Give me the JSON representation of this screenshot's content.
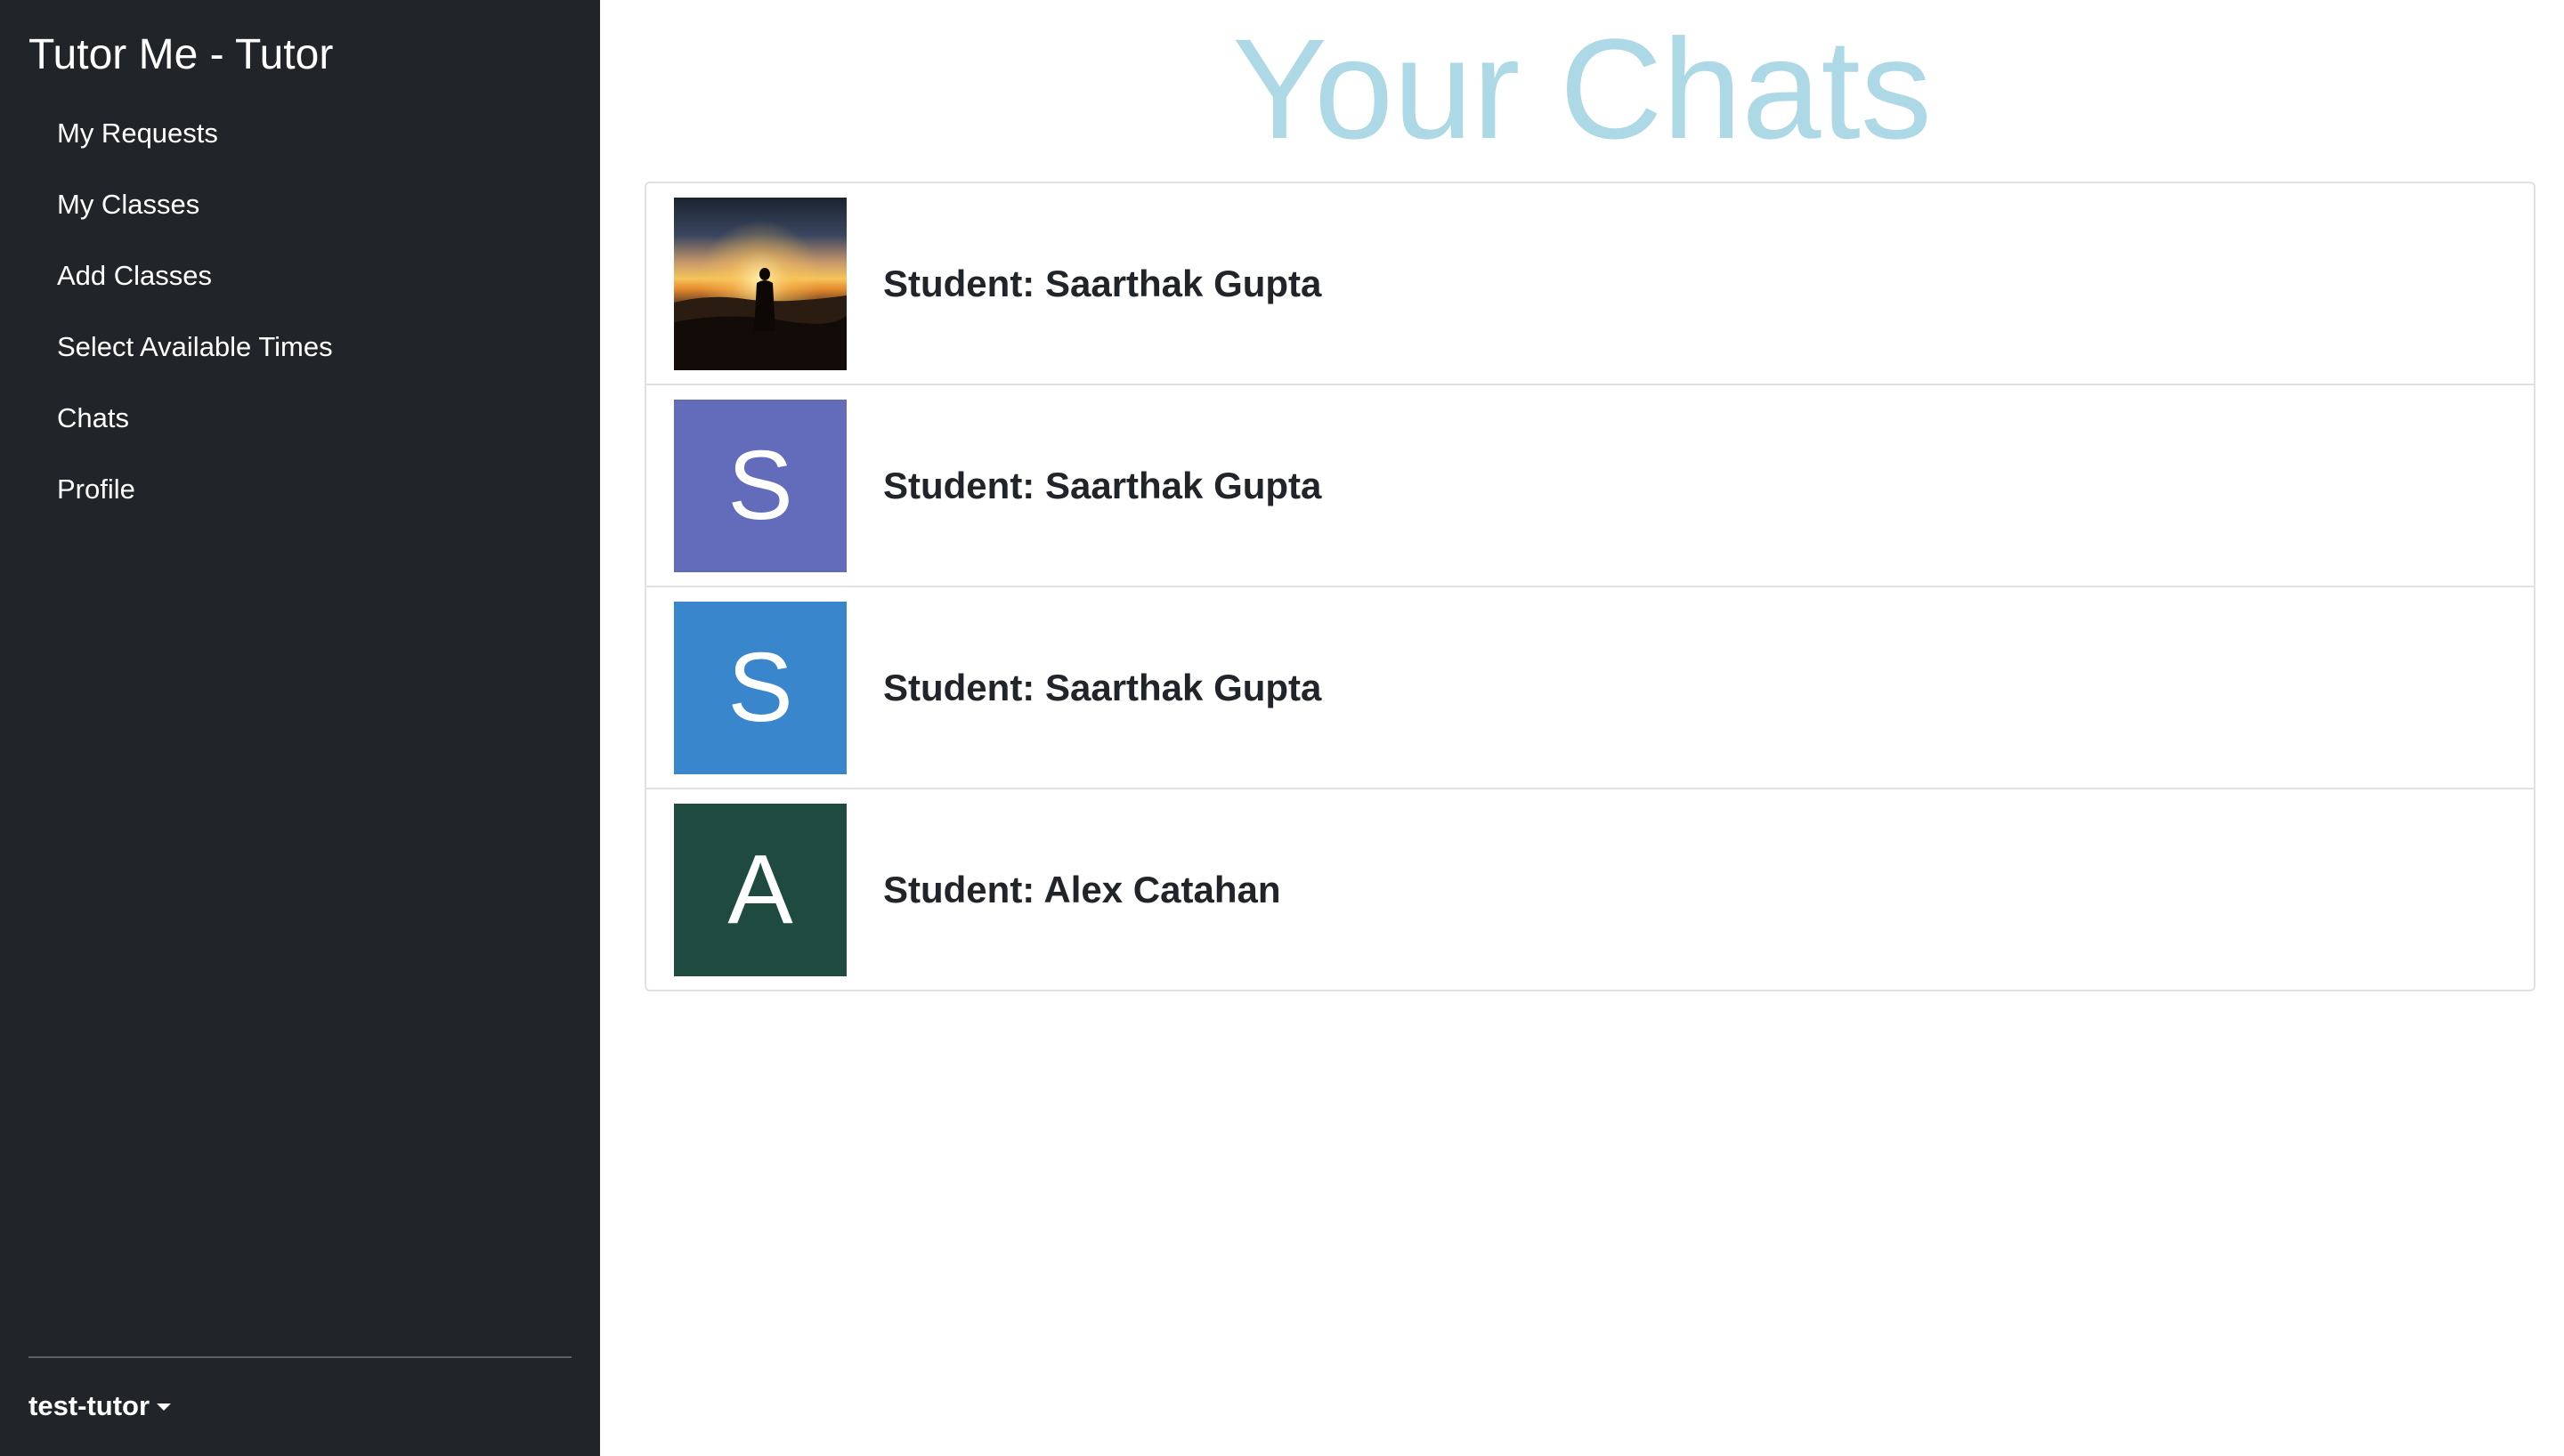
{
  "sidebar": {
    "brand": "Tutor Me - Tutor",
    "nav": [
      {
        "label": "My Requests"
      },
      {
        "label": "My Classes"
      },
      {
        "label": "Add Classes"
      },
      {
        "label": "Select Available Times"
      },
      {
        "label": "Chats"
      },
      {
        "label": "Profile"
      }
    ],
    "user": "test-tutor",
    "user_menu_icon": "caret-down-icon"
  },
  "main": {
    "title": "Your Chats",
    "title_color": "#add8e6",
    "chats": [
      {
        "label": "Student: Saarthak Gupta",
        "avatar_type": "photo",
        "avatar_icon": "sunset-silhouette-photo"
      },
      {
        "label": "Student: Saarthak Gupta",
        "avatar_type": "initial",
        "initial": "S",
        "color": "#636bbb"
      },
      {
        "label": "Student: Saarthak Gupta",
        "avatar_type": "initial",
        "initial": "S",
        "color": "#3a86cc"
      },
      {
        "label": "Student: Alex Catahan",
        "avatar_type": "initial",
        "initial": "A",
        "color": "#1f4a40"
      }
    ]
  },
  "colors": {
    "sidebar_bg": "#212529",
    "text_dark": "#212529",
    "border": "#dee2e6"
  }
}
